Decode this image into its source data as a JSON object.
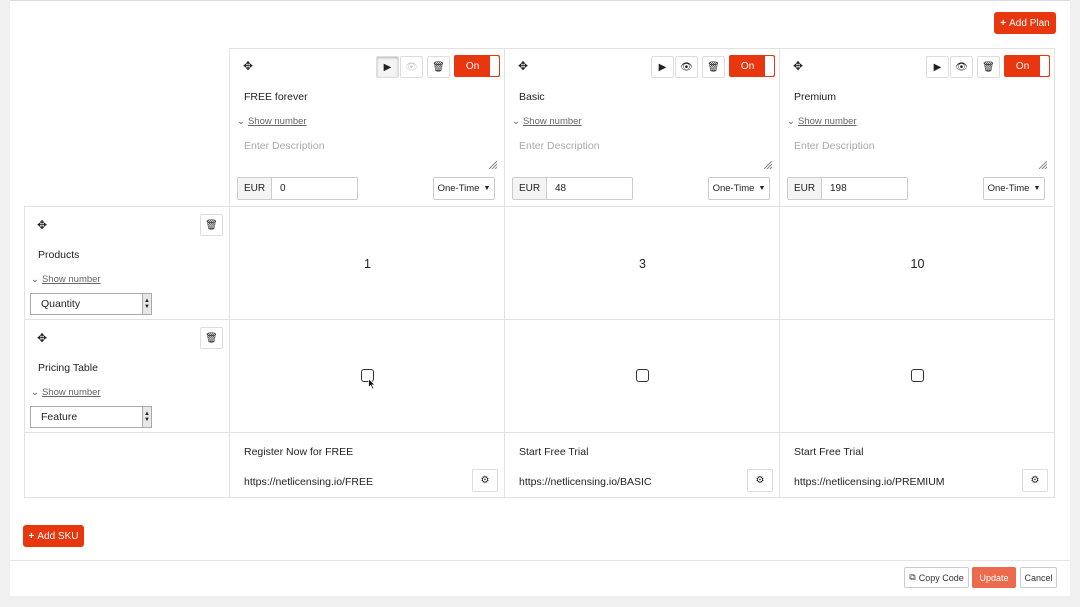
{
  "toolbar": {
    "add_plan_label": "Add Plan",
    "add_sku_label": "Add SKU"
  },
  "plans": [
    {
      "name": "FREE forever",
      "show_number": "Show number",
      "description_placeholder": "Enter Description",
      "toggle": "On",
      "currency": "EUR",
      "price": "0",
      "period": "One-Time",
      "cta": "Register Now for FREE",
      "url": "https://netlicensing.io/FREE"
    },
    {
      "name": "Basic",
      "show_number": "Show number",
      "description_placeholder": "Enter Description",
      "toggle": "On",
      "currency": "EUR",
      "price": "48",
      "period": "One-Time",
      "cta": "Start Free Trial",
      "url": "https://netlicensing.io/BASIC"
    },
    {
      "name": "Premium",
      "show_number": "Show number",
      "description_placeholder": "Enter Description",
      "toggle": "On",
      "currency": "EUR",
      "price": "198",
      "period": "One-Time",
      "cta": "Start Free Trial",
      "url": "https://netlicensing.io/PREMIUM"
    }
  ],
  "features": [
    {
      "name": "Products",
      "show_number": "Show number",
      "type": "Quantity",
      "values": [
        "1",
        "3",
        "10"
      ]
    },
    {
      "name": "Pricing Table",
      "show_number": "Show number",
      "type": "Feature",
      "checked": [
        false,
        false,
        false
      ]
    }
  ],
  "footer": {
    "copy_code_label": "Copy Code",
    "update_label": "Update",
    "cancel_label": "Cancel"
  },
  "colors": {
    "accent": "#e8360f",
    "update_button": "#ec6a4d"
  }
}
